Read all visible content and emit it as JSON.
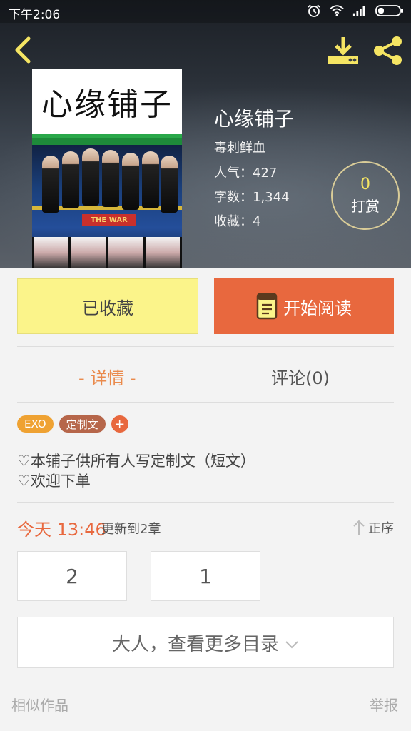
{
  "status_bar": {
    "time": "下午2:06"
  },
  "book": {
    "cover_title": "心缘铺子",
    "cover_banner": "THE WAR",
    "title": "心缘铺子",
    "author": "毒刺鲜血",
    "popularity": "人气：427",
    "word_count": "字数：1,344",
    "favorites": "收藏：4"
  },
  "tip": {
    "count": "0",
    "label": "打赏"
  },
  "actions": {
    "collected_label": "已收藏",
    "read_label": "开始阅读"
  },
  "tabs": [
    {
      "label": "- 详情 -",
      "active": true
    },
    {
      "label": "评论(0)",
      "active": false
    }
  ],
  "tags": [
    {
      "label": "EXO",
      "color": "#efa232"
    },
    {
      "label": "定制文",
      "color": "#b6664a"
    }
  ],
  "tag_add": "+",
  "description": [
    "♡本铺子供所有人写定制文（短文）",
    "♡欢迎下单"
  ],
  "update": {
    "time": "今天 13:46",
    "text": "更新到2章",
    "sort_label": "正序"
  },
  "chapters": [
    {
      "label": "2"
    },
    {
      "label": "1"
    }
  ],
  "more_catalog": "大人，查看更多目录",
  "footer": {
    "similar": "相似作品",
    "report": "举报"
  },
  "colors": {
    "accent": "#e8683e",
    "collected_bg": "#fbf48a",
    "tip_count": "#f5e563"
  }
}
